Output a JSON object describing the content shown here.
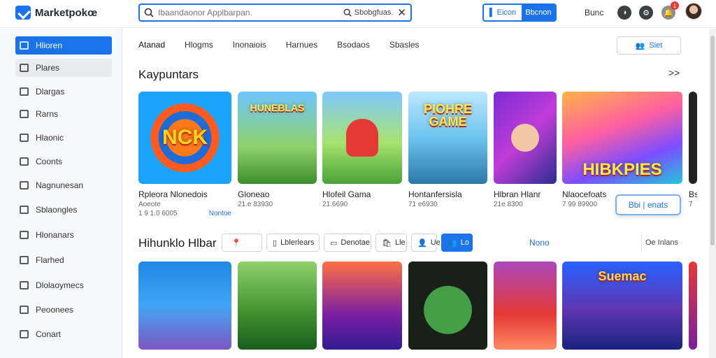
{
  "header": {
    "logo_text": "Marketpokœ",
    "search_placeholder": "Ibaandaonor Applbarpan.",
    "scope_label": "Sbobgfuas.",
    "auth_left": "Eicon",
    "auth_right": "Bbcnon",
    "link": "Bunc",
    "notification_count": "1"
  },
  "sidebar": {
    "items": [
      {
        "label": "Hlioren",
        "icon": "home-icon"
      },
      {
        "label": "Plares",
        "icon": "square-icon"
      },
      {
        "label": "Dlargas",
        "icon": "square-icon"
      },
      {
        "label": "Rarns",
        "icon": "square-icon"
      },
      {
        "label": "Hlaonic",
        "icon": "grid-icon"
      },
      {
        "label": "Coonts",
        "icon": "square-icon"
      },
      {
        "label": "Nagnunesan",
        "icon": "gear-icon"
      },
      {
        "label": "Sblaongles",
        "icon": "star-icon"
      },
      {
        "label": "Hlonanars",
        "icon": "folder-icon"
      },
      {
        "label": "Flarhed",
        "icon": "folder-icon"
      },
      {
        "label": "Dlolaoymecs",
        "icon": "chart-icon"
      },
      {
        "label": "Peoonees",
        "icon": "card-icon"
      },
      {
        "label": "Conart",
        "icon": "lock-icon"
      }
    ]
  },
  "tabs": [
    "Atanad",
    "Hlogms",
    "Inonaiois",
    "Harnues",
    "Bsodaos",
    "Sbasles"
  ],
  "filter_button": "Siet",
  "section1": {
    "title": "Kaypuntars",
    "cards": [
      {
        "title": "Rpleora Nlonedois",
        "sub": "Aoeote",
        "meta": "1 9 1.0 6005",
        "link": "Nontoe",
        "art": "NCK"
      },
      {
        "title": "Gloneao",
        "sub": "",
        "meta": "21.e 83930",
        "link": "",
        "art": "HUNEBLAS"
      },
      {
        "title": "Hlofeil Gama",
        "sub": "",
        "meta": "21.6690",
        "link": "",
        "art": ""
      },
      {
        "title": "Hontanfersisla",
        "sub": "",
        "meta": "71 e6930",
        "link": "",
        "art": "PIOHRE GAME"
      },
      {
        "title": "Hlbran Hlanr",
        "sub": "",
        "meta": "21e 8300",
        "link": "",
        "art": ""
      },
      {
        "title": "Nlaocefoats",
        "sub": "",
        "meta": "7 99 89900",
        "link": "",
        "art": "HIBKPIES"
      }
    ],
    "partial_card_title": "Bs",
    "partial_card_meta": "7",
    "overlay_button": "Bbi | enats"
  },
  "section2": {
    "title": "Hihunklo Hlbar",
    "chips": [
      {
        "label": "",
        "icon": "pin-icon"
      },
      {
        "label": "Lblerlears",
        "icon": "list-icon"
      },
      {
        "label": "Denotae",
        "icon": "minus-icon"
      },
      {
        "label": "Lle",
        "icon": "bag-icon"
      },
      {
        "label": "Ue",
        "icon": "person-icon"
      },
      {
        "label": "Lo",
        "icon": "people-icon"
      }
    ],
    "more_link": "Nono",
    "sort_label": "Oe Inlans",
    "cards": [
      {
        "art": ""
      },
      {
        "art": ""
      },
      {
        "art": ""
      },
      {
        "art": ""
      },
      {
        "art": ""
      },
      {
        "art": "Suemac"
      }
    ]
  }
}
